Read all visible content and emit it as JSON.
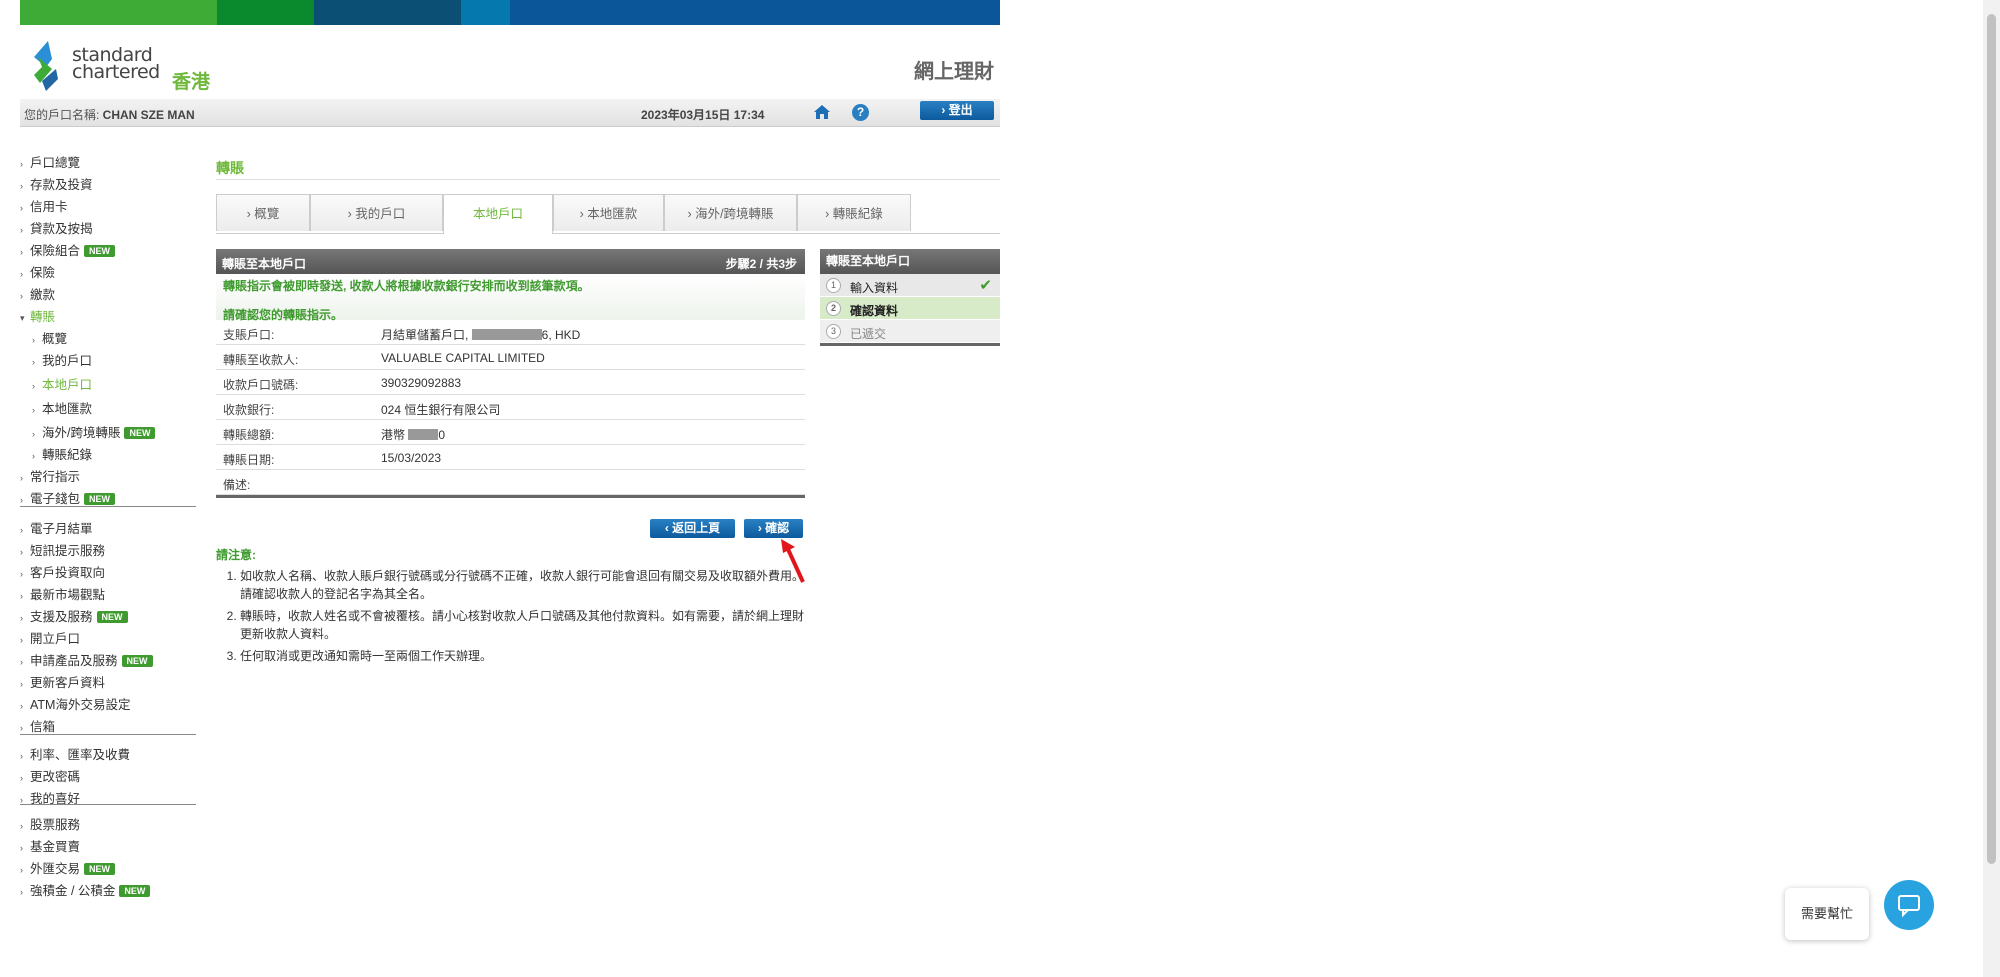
{
  "header": {
    "brand_line1": "standard",
    "brand_line2": "chartered",
    "region": "香港",
    "service_title": "網上理財",
    "colors": [
      "#3eab37",
      "#0a8a2c",
      "#0c4f74",
      "#0579ad",
      "#0a5699"
    ]
  },
  "userbar": {
    "account_label": "您的戶口名稱: ",
    "account_name": "CHAN SZE MAN",
    "datetime": "2023年03月15日 17:34",
    "help_label": "?",
    "logout_label": "登出"
  },
  "sidebar": {
    "items": [
      {
        "label": "戶口總覽"
      },
      {
        "label": "存款及投資"
      },
      {
        "label": "信用卡"
      },
      {
        "label": "貸款及按揭"
      },
      {
        "label": "保險組合",
        "badge": "NEW"
      },
      {
        "label": "保險"
      },
      {
        "label": "繳款"
      },
      {
        "label": "轉賬",
        "active": true
      },
      {
        "label": "概覽",
        "sub": true
      },
      {
        "label": "我的戶口",
        "sub": true
      },
      {
        "label": "本地戶口",
        "sub": true,
        "active": true
      },
      {
        "label": "本地匯款",
        "sub": true
      },
      {
        "label": "海外/跨境轉賬",
        "sub": true,
        "badge": "NEW"
      },
      {
        "label": "轉賬紀錄",
        "sub": true
      },
      {
        "label": "常行指示"
      },
      {
        "label": "電子錢包",
        "badge": "NEW"
      },
      {
        "label": "電子月結單"
      },
      {
        "label": "短訊提示服務"
      },
      {
        "label": "客戶投資取向"
      },
      {
        "label": "最新市場觀點"
      },
      {
        "label": "支援及服務",
        "badge": "NEW"
      },
      {
        "label": "開立戶口"
      },
      {
        "label": "申請產品及服務",
        "badge": "NEW"
      },
      {
        "label": "更新客戶資料"
      },
      {
        "label": "ATM海外交易設定"
      },
      {
        "label": "信箱"
      },
      {
        "label": "利率、匯率及收費"
      },
      {
        "label": "更改密碼"
      },
      {
        "label": "我的喜好"
      },
      {
        "label": "股票服務"
      },
      {
        "label": "基金買賣"
      },
      {
        "label": "外匯交易",
        "badge": "NEW"
      },
      {
        "label": "強積金 / 公積金",
        "badge": "NEW"
      }
    ]
  },
  "main": {
    "page_title": "轉賬",
    "tabs": [
      {
        "label": "› 概覽"
      },
      {
        "label": "› 我的戶口"
      },
      {
        "label": "本地戶口",
        "active": true
      },
      {
        "label": "› 本地匯款"
      },
      {
        "label": "› 海外/跨境轉賬"
      },
      {
        "label": "› 轉賬紀錄"
      }
    ],
    "panel_title": "轉賬至本地戶口",
    "step_label": "步驟2 / 共3步",
    "notice": "轉賬指示會被即時發送, 收款人將根據收款銀行安排而收到該筆款項。",
    "confirm_prompt": "請確認您的轉賬指示。",
    "rows": [
      {
        "key": "支賬戶口:",
        "value": "月結單儲蓄戶口, ",
        "value_end": "6, HKD"
      },
      {
        "key": "轉賬至收款人:",
        "value": "VALUABLE CAPITAL LIMITED"
      },
      {
        "key": "收款戶口號碼:",
        "value": "390329092883"
      },
      {
        "key": "收款銀行:",
        "value": "024 恒生銀行有限公司"
      },
      {
        "key": "轉賬總額:",
        "value": "港幣  ",
        "value_end": "0"
      },
      {
        "key": "轉賬日期:",
        "value": "15/03/2023"
      },
      {
        "key": "備述:",
        "value": ""
      }
    ],
    "back_button": "返回上頁",
    "confirm_button": "確認",
    "notes_title": "請注意:",
    "notes": [
      "如收款人名稱、收款人賬戶銀行號碼或分行號碼不正確，收款人銀行可能會退回有關交易及收取額外費用。請確認收款人的登記名字為其全名。",
      "轉賬時，收款人姓名或不會被覆核。請小心核對收款人戶口號碼及其他付款資料。如有需要，請於網上理財更新收款人資料。",
      "任何取消或更改通知需時一至兩個工作天辦理。"
    ]
  },
  "steps": {
    "title": "轉賬至本地戶口",
    "items": [
      {
        "num": "1",
        "label": "輸入資料",
        "state": "done"
      },
      {
        "num": "2",
        "label": "確認資料",
        "state": "current"
      },
      {
        "num": "3",
        "label": "已遞交",
        "state": "pending"
      }
    ]
  },
  "chat": {
    "help_text": "需要幫忙"
  }
}
